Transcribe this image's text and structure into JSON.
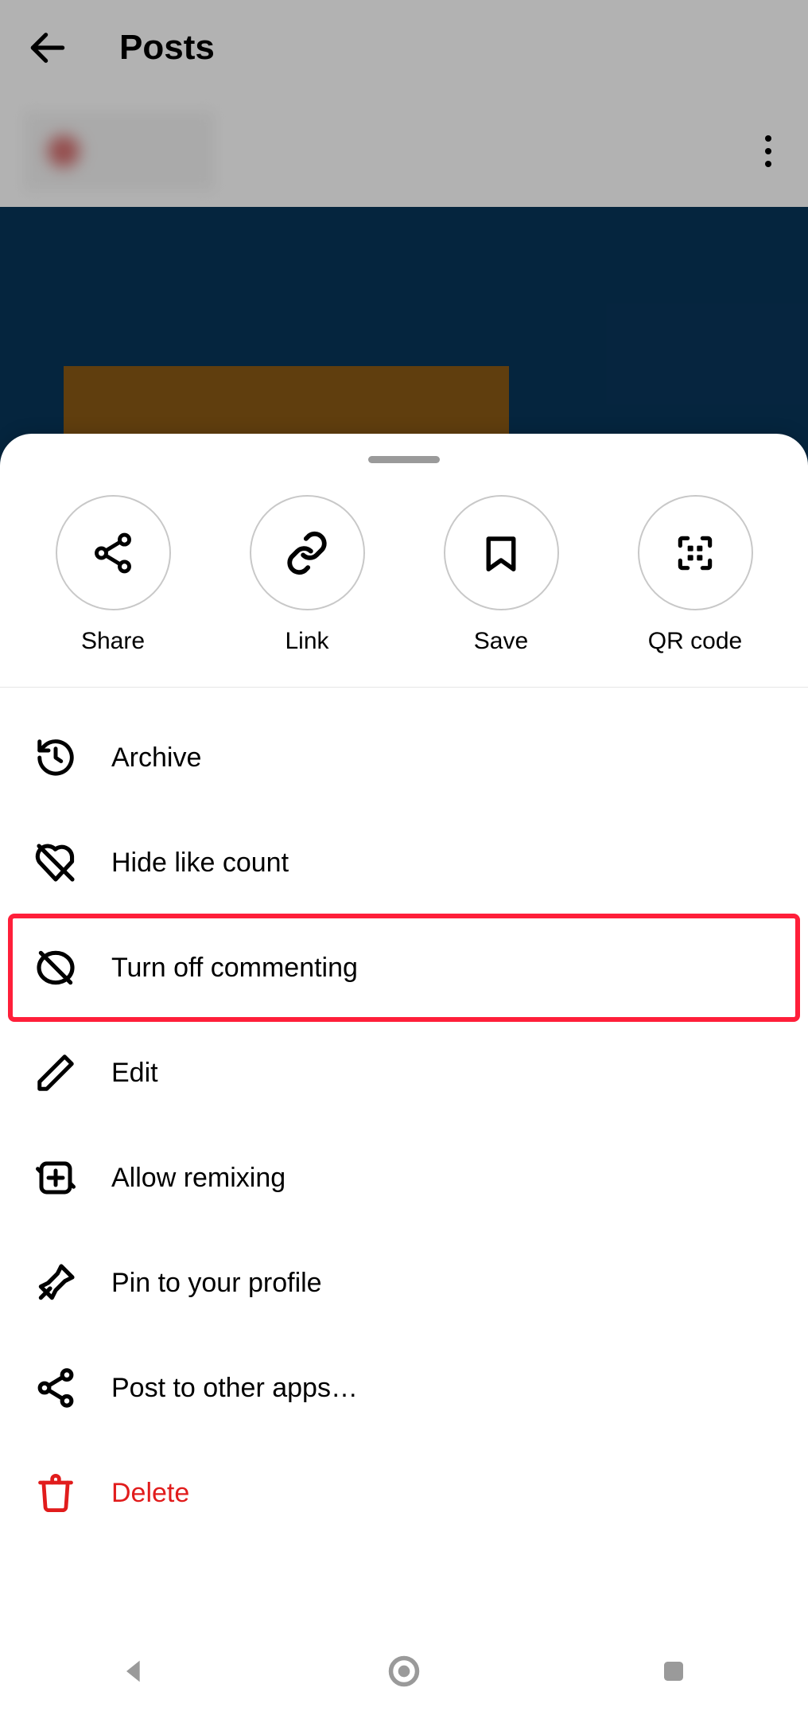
{
  "header": {
    "title": "Posts"
  },
  "quick": [
    {
      "label": "Share",
      "icon": "share-icon"
    },
    {
      "label": "Link",
      "icon": "link-icon"
    },
    {
      "label": "Save",
      "icon": "bookmark-icon"
    },
    {
      "label": "QR code",
      "icon": "qr-icon"
    }
  ],
  "menu": [
    {
      "label": "Archive",
      "icon": "archive-icon",
      "danger": false,
      "highlight": false
    },
    {
      "label": "Hide like count",
      "icon": "heart-off-icon",
      "danger": false,
      "highlight": false
    },
    {
      "label": "Turn off commenting",
      "icon": "comment-off-icon",
      "danger": false,
      "highlight": true
    },
    {
      "label": "Edit",
      "icon": "edit-icon",
      "danger": false,
      "highlight": false
    },
    {
      "label": "Allow remixing",
      "icon": "remix-icon",
      "danger": false,
      "highlight": false
    },
    {
      "label": "Pin to your profile",
      "icon": "pin-icon",
      "danger": false,
      "highlight": false
    },
    {
      "label": "Post to other apps…",
      "icon": "share-alt-icon",
      "danger": false,
      "highlight": false
    },
    {
      "label": "Delete",
      "icon": "trash-icon",
      "danger": true,
      "highlight": false
    }
  ]
}
